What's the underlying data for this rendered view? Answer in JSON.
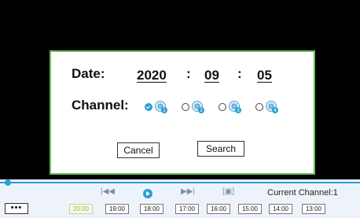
{
  "dialog": {
    "date_label": "Date:",
    "year": "2020",
    "month": "09",
    "day": "05",
    "date_separator": ":",
    "channel_label": "Channel:",
    "channels": [
      {
        "number": "1",
        "selected": true
      },
      {
        "number": "2",
        "selected": false
      },
      {
        "number": "3",
        "selected": false
      },
      {
        "number": "4",
        "selected": false
      }
    ],
    "cancel_label": "Cancel",
    "search_label": "Search"
  },
  "playback": {
    "controls": {
      "prev_icon": "skip-back-icon",
      "play_icon": "play-icon",
      "next_icon": "skip-forward-icon",
      "fullscreen_icon": "fullscreen-icon",
      "prev_glyph": "|◀◀",
      "next_glyph": "▶▶|",
      "fullscreen_glyph": "[▣]"
    },
    "current_channel": "Current Channel:1",
    "more_label": "•••",
    "time_slots": [
      "20:00",
      "19:00",
      "18:00",
      "17:00",
      "16:00",
      "15:00",
      "14:00",
      "13:00"
    ],
    "active_slot": "20:00"
  },
  "colors": {
    "dialog_border": "#6bbd5b",
    "accent": "#2a9fd8",
    "bottom_bar": "#eef3fb"
  }
}
